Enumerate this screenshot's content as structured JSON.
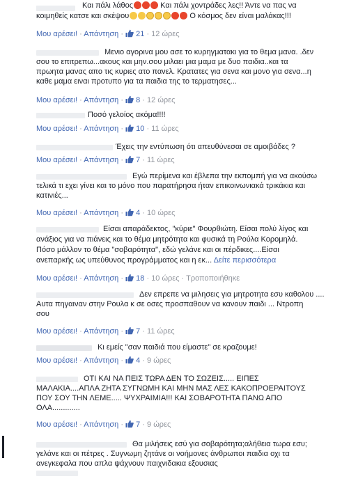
{
  "comments": [
    {
      "lines": [
        "Και πάλι λάθος",
        " Και πάλι χοντράδες λες!! Άντε να πας να",
        "κοιμηθείς κατσε και σκέψου",
        " Ο κόσμος δεν είναι μαλάκας!!!"
      ],
      "like_label": "Μου αρέσει!",
      "reply_label": "Απάντηση",
      "likes": "21",
      "time": "12 ώρες"
    },
    {
      "lines": [
        "Μενιο αγορινα μου ασε το κυρηγματακι για το θεμα μανα. .δεν",
        "σου το επιτρεπω...ακους και μην.σου μιλαει μια μαμα με δυο παιδια..και τα",
        "πρωητα μανας απο τις κυριες ατο πανελ. Κρατατες για σενα και μονο για σενα...η",
        "καθε μαμα ειναι προτυπο για τα παιδια της το τερματησες..."
      ],
      "like_label": "Μου αρέσει!",
      "reply_label": "Απάντηση",
      "likes": "8",
      "time": "12 ώρες"
    },
    {
      "lines": [
        "Ποσό γελοίος ακόμα!!!!"
      ],
      "like_label": "Μου αρέσει!",
      "reply_label": "Απάντηση",
      "likes": "10",
      "time": "11 ώρες"
    },
    {
      "lines": [
        "Έχεις την εντύπωση ότι απευθύνεσαι σε αμοιβάδες ?"
      ],
      "like_label": "Μου αρέσει!",
      "reply_label": "Απάντηση",
      "likes": "7",
      "time": "11 ώρες"
    },
    {
      "lines": [
        "Εγώ περίμενα και έβλεπα την εκπομπή για να ακούσω",
        "τελικά τι εχει γίνει και το μόνο που παρατήρησα ήταν επικοινωνιακά τρικάκια και",
        "κατινιές..."
      ],
      "like_label": "Μου αρέσει!",
      "reply_label": "Απάντηση",
      "likes": "4",
      "time": "10 ώρες"
    },
    {
      "lines": [
        "Είσαι απαράδεκτος, \"κύριε\" Φουρθιώτη. Είσαι πολύ λίγος και",
        "ανάξιος για να πιάνεις και το θέμα μητρότητα και φυσικά τη Ρούλα Κορομηλά.",
        "Πόσο μάλλον το θέμα \"σοβαρότητα\", εδώ γελάνε και οι πέρδικες....Είσαι",
        "ανεπαρκής ως υπεύθυνος προγράμματος και η εκ..."
      ],
      "see_more": "Δείτε περισσότερα",
      "like_label": "Μου αρέσει!",
      "reply_label": "Απάντηση",
      "likes": "18",
      "time": "10 ώρες",
      "edit_label": "Τροποποιήθηκε"
    },
    {
      "lines": [
        "Δεν επρεπε να μιλησεις για μητροτητα εσυ καθολου ....",
        "Αυτα πηγαιναν στην Ρουλα κ σε οσες προσπαθουν να κανουν παιδι ... Ντροπη",
        "σου"
      ],
      "like_label": "Μου αρέσει!",
      "reply_label": "Απάντηση",
      "likes": "7",
      "time": "11 ώρες"
    },
    {
      "lines": [
        "Κι εμείς \"σαν παιδιά που είμαστε\" σε κραζουμε!"
      ],
      "like_label": "Μου αρέσει!",
      "reply_label": "Απάντηση",
      "likes": "4",
      "time": "9 ώρες"
    },
    {
      "lines": [
        "ΟΤΙ ΚΑΙ ΝΑ ΠΕΙΣ ΤΩΡΑ ΔΕΝ ΤΟ ΣΩΖΕΙΣ..... ΕΙΠΕΣ",
        "ΜΑΛΑΚΙΑ....ΑΠΛΑ ΖΗΤΑ ΣΥΓΝΩΜΗ ΚΑΙ ΜΗΝ ΜΑΣ ΛΕΣ ΚΑΚΟΠΡΟΕΡΑΙΤΟΥΣ",
        "ΠΟΥ ΣΟΥ ΤΗΝ ΛΕΜΕ..... ΨΥΧΡΑΙΜΙΑ!!! ΚΑΙ ΣΟΒΑΡΟΤΗΤΑ ΠΑΝΩ ΑΠΟ",
        "ΟΛΑ............."
      ],
      "like_label": "Μου αρέσει!",
      "reply_label": "Απάντηση",
      "likes": "7",
      "time": "9 ώρες"
    },
    {
      "lines": [
        "Θα μιλήσεις εσύ για σοβαρότητα;αλήθεια τωρα εσυ;",
        "γελάνε και οι πέτρες . Συγνωμη ζητάνε οι νοήμονες άνθρωποι παιδια οχι τα",
        "ανεγκεφαλα που απλα ψάχνουν παιχνιδακια εξουσιας"
      ]
    }
  ]
}
